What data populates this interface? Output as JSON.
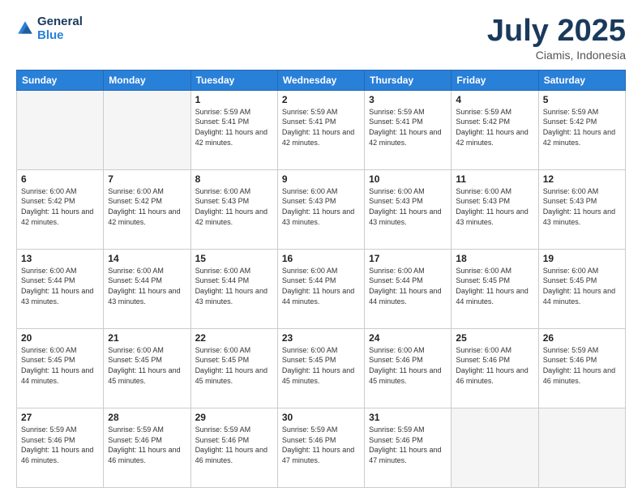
{
  "header": {
    "logo_line1": "General",
    "logo_line2": "Blue",
    "title": "July 2025",
    "location": "Ciamis, Indonesia"
  },
  "weekdays": [
    "Sunday",
    "Monday",
    "Tuesday",
    "Wednesday",
    "Thursday",
    "Friday",
    "Saturday"
  ],
  "weeks": [
    [
      {
        "day": "",
        "empty": true
      },
      {
        "day": "",
        "empty": true
      },
      {
        "day": "1",
        "sunrise": "5:59 AM",
        "sunset": "5:41 PM",
        "daylight": "11 hours and 42 minutes."
      },
      {
        "day": "2",
        "sunrise": "5:59 AM",
        "sunset": "5:41 PM",
        "daylight": "11 hours and 42 minutes."
      },
      {
        "day": "3",
        "sunrise": "5:59 AM",
        "sunset": "5:41 PM",
        "daylight": "11 hours and 42 minutes."
      },
      {
        "day": "4",
        "sunrise": "5:59 AM",
        "sunset": "5:42 PM",
        "daylight": "11 hours and 42 minutes."
      },
      {
        "day": "5",
        "sunrise": "5:59 AM",
        "sunset": "5:42 PM",
        "daylight": "11 hours and 42 minutes."
      }
    ],
    [
      {
        "day": "6",
        "sunrise": "6:00 AM",
        "sunset": "5:42 PM",
        "daylight": "11 hours and 42 minutes."
      },
      {
        "day": "7",
        "sunrise": "6:00 AM",
        "sunset": "5:42 PM",
        "daylight": "11 hours and 42 minutes."
      },
      {
        "day": "8",
        "sunrise": "6:00 AM",
        "sunset": "5:43 PM",
        "daylight": "11 hours and 42 minutes."
      },
      {
        "day": "9",
        "sunrise": "6:00 AM",
        "sunset": "5:43 PM",
        "daylight": "11 hours and 43 minutes."
      },
      {
        "day": "10",
        "sunrise": "6:00 AM",
        "sunset": "5:43 PM",
        "daylight": "11 hours and 43 minutes."
      },
      {
        "day": "11",
        "sunrise": "6:00 AM",
        "sunset": "5:43 PM",
        "daylight": "11 hours and 43 minutes."
      },
      {
        "day": "12",
        "sunrise": "6:00 AM",
        "sunset": "5:43 PM",
        "daylight": "11 hours and 43 minutes."
      }
    ],
    [
      {
        "day": "13",
        "sunrise": "6:00 AM",
        "sunset": "5:44 PM",
        "daylight": "11 hours and 43 minutes."
      },
      {
        "day": "14",
        "sunrise": "6:00 AM",
        "sunset": "5:44 PM",
        "daylight": "11 hours and 43 minutes."
      },
      {
        "day": "15",
        "sunrise": "6:00 AM",
        "sunset": "5:44 PM",
        "daylight": "11 hours and 43 minutes."
      },
      {
        "day": "16",
        "sunrise": "6:00 AM",
        "sunset": "5:44 PM",
        "daylight": "11 hours and 44 minutes."
      },
      {
        "day": "17",
        "sunrise": "6:00 AM",
        "sunset": "5:44 PM",
        "daylight": "11 hours and 44 minutes."
      },
      {
        "day": "18",
        "sunrise": "6:00 AM",
        "sunset": "5:45 PM",
        "daylight": "11 hours and 44 minutes."
      },
      {
        "day": "19",
        "sunrise": "6:00 AM",
        "sunset": "5:45 PM",
        "daylight": "11 hours and 44 minutes."
      }
    ],
    [
      {
        "day": "20",
        "sunrise": "6:00 AM",
        "sunset": "5:45 PM",
        "daylight": "11 hours and 44 minutes."
      },
      {
        "day": "21",
        "sunrise": "6:00 AM",
        "sunset": "5:45 PM",
        "daylight": "11 hours and 45 minutes."
      },
      {
        "day": "22",
        "sunrise": "6:00 AM",
        "sunset": "5:45 PM",
        "daylight": "11 hours and 45 minutes."
      },
      {
        "day": "23",
        "sunrise": "6:00 AM",
        "sunset": "5:45 PM",
        "daylight": "11 hours and 45 minutes."
      },
      {
        "day": "24",
        "sunrise": "6:00 AM",
        "sunset": "5:46 PM",
        "daylight": "11 hours and 45 minutes."
      },
      {
        "day": "25",
        "sunrise": "6:00 AM",
        "sunset": "5:46 PM",
        "daylight": "11 hours and 46 minutes."
      },
      {
        "day": "26",
        "sunrise": "5:59 AM",
        "sunset": "5:46 PM",
        "daylight": "11 hours and 46 minutes."
      }
    ],
    [
      {
        "day": "27",
        "sunrise": "5:59 AM",
        "sunset": "5:46 PM",
        "daylight": "11 hours and 46 minutes."
      },
      {
        "day": "28",
        "sunrise": "5:59 AM",
        "sunset": "5:46 PM",
        "daylight": "11 hours and 46 minutes."
      },
      {
        "day": "29",
        "sunrise": "5:59 AM",
        "sunset": "5:46 PM",
        "daylight": "11 hours and 46 minutes."
      },
      {
        "day": "30",
        "sunrise": "5:59 AM",
        "sunset": "5:46 PM",
        "daylight": "11 hours and 47 minutes."
      },
      {
        "day": "31",
        "sunrise": "5:59 AM",
        "sunset": "5:46 PM",
        "daylight": "11 hours and 47 minutes."
      },
      {
        "day": "",
        "empty": true
      },
      {
        "day": "",
        "empty": true
      }
    ]
  ]
}
